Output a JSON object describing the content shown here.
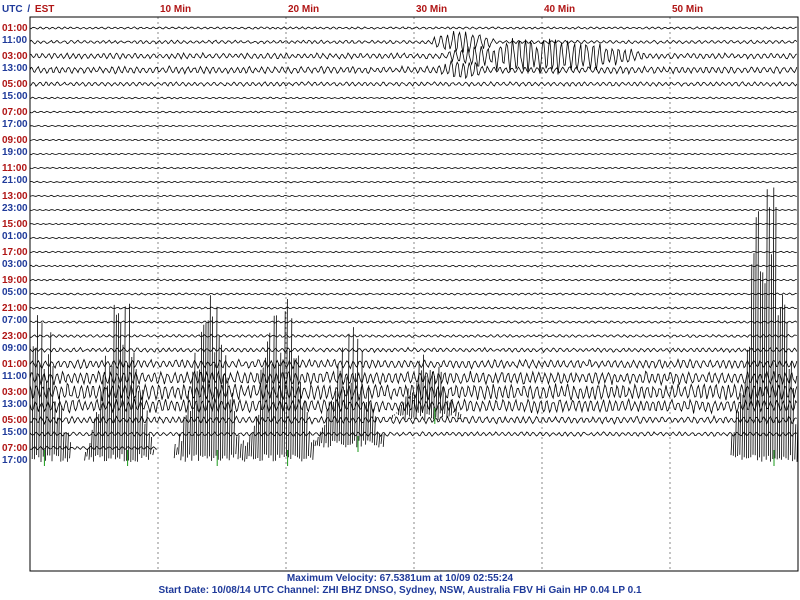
{
  "header": {
    "utc_label": "UTC",
    "separator": "/",
    "local_label": "EST"
  },
  "colors": {
    "utc": "#1f3a9a",
    "local": "#b01515",
    "trace": "#000000",
    "grid": "#888888",
    "spike": "#1a9a1a"
  },
  "footer": {
    "max_velocity": "Maximum Velocity: 67.5381um at 10/09 02:55:24",
    "start_info": "Start Date: 10/08/14 UTC Channel: ZHI  BHZ  DNSO, Sydney, NSW, Australia  FBV Hi Gain HP 0.04 LP 0.1"
  },
  "chart_data": {
    "type": "line",
    "title": "",
    "xlabel": "",
    "ylabel": "",
    "x_unit": "minutes",
    "xlim": [
      0,
      60
    ],
    "x_ticks": [
      {
        "value": 10,
        "label": "10 Min"
      },
      {
        "value": 20,
        "label": "20 Min"
      },
      {
        "value": 30,
        "label": "30 Min"
      },
      {
        "value": 40,
        "label": "40 Min"
      },
      {
        "value": 50,
        "label": "50 Min"
      }
    ],
    "rows": [
      {
        "utc": "01:00",
        "local": "11:00",
        "amplitude": 0.08
      },
      {
        "utc": "",
        "local": "",
        "amplitude": 0.12,
        "event": {
          "start": 31,
          "end": 40,
          "peak": 1.4
        }
      },
      {
        "utc": "03:00",
        "local": "13:00",
        "amplitude": 0.2,
        "event": {
          "start": 31,
          "end": 60,
          "peak": 1.8
        }
      },
      {
        "utc": "",
        "local": "",
        "amplitude": 0.25,
        "event": {
          "start": 31,
          "end": 40,
          "peak": 1.0
        }
      },
      {
        "utc": "05:00",
        "local": "15:00",
        "amplitude": 0.15
      },
      {
        "utc": "",
        "local": "",
        "amplitude": 0.06
      },
      {
        "utc": "07:00",
        "local": "17:00",
        "amplitude": 0.06
      },
      {
        "utc": "",
        "local": "",
        "amplitude": 0.05
      },
      {
        "utc": "09:00",
        "local": "19:00",
        "amplitude": 0.05
      },
      {
        "utc": "",
        "local": "",
        "amplitude": 0.05
      },
      {
        "utc": "11:00",
        "local": "21:00",
        "amplitude": 0.05
      },
      {
        "utc": "",
        "local": "",
        "amplitude": 0.05
      },
      {
        "utc": "13:00",
        "local": "23:00",
        "amplitude": 0.05
      },
      {
        "utc": "",
        "local": "",
        "amplitude": 0.05
      },
      {
        "utc": "15:00",
        "local": "01:00",
        "amplitude": 0.05
      },
      {
        "utc": "",
        "local": "",
        "amplitude": 0.05
      },
      {
        "utc": "17:00",
        "local": "03:00",
        "amplitude": 0.05
      },
      {
        "utc": "",
        "local": "",
        "amplitude": 0.06
      },
      {
        "utc": "19:00",
        "local": "05:00",
        "amplitude": 0.06
      },
      {
        "utc": "",
        "local": "",
        "amplitude": 0.07
      },
      {
        "utc": "21:00",
        "local": "07:00",
        "amplitude": 0.07
      },
      {
        "utc": "",
        "local": "",
        "amplitude": 0.08
      },
      {
        "utc": "23:00",
        "local": "09:00",
        "amplitude": 0.1
      },
      {
        "utc": "",
        "local": "",
        "amplitude": 0.15
      },
      {
        "utc": "01:00",
        "local": "11:00",
        "amplitude": 0.3
      },
      {
        "utc": "",
        "local": "",
        "amplitude": 0.45
      },
      {
        "utc": "03:00",
        "local": "13:00",
        "amplitude": 0.55
      },
      {
        "utc": "",
        "local": "",
        "amplitude": 0.45
      },
      {
        "utc": "05:00",
        "local": "15:00",
        "amplitude": 0.25
      },
      {
        "utc": "",
        "local": "",
        "amplitude": 0.15
      },
      {
        "utc": "07:00",
        "local": "17:00",
        "amplitude": 0.12,
        "end_minute": 10
      }
    ],
    "spike_bursts": [
      {
        "center": 0.5,
        "row_top": 18,
        "row_bottom": 31,
        "peak": 1.0
      },
      {
        "center": 7,
        "row_top": 17,
        "row_bottom": 31,
        "peak": 1.0
      },
      {
        "center": 14,
        "row_top": 18,
        "row_bottom": 31,
        "peak": 1.0
      },
      {
        "center": 19.5,
        "row_top": 17,
        "row_bottom": 31,
        "peak": 1.0
      },
      {
        "center": 25,
        "row_top": 19,
        "row_bottom": 30,
        "peak": 0.8
      },
      {
        "center": 31,
        "row_top": 21,
        "row_bottom": 28,
        "peak": 0.7
      },
      {
        "center": 57.5,
        "row_top": 9,
        "row_bottom": 31,
        "peak": 1.0
      }
    ]
  }
}
